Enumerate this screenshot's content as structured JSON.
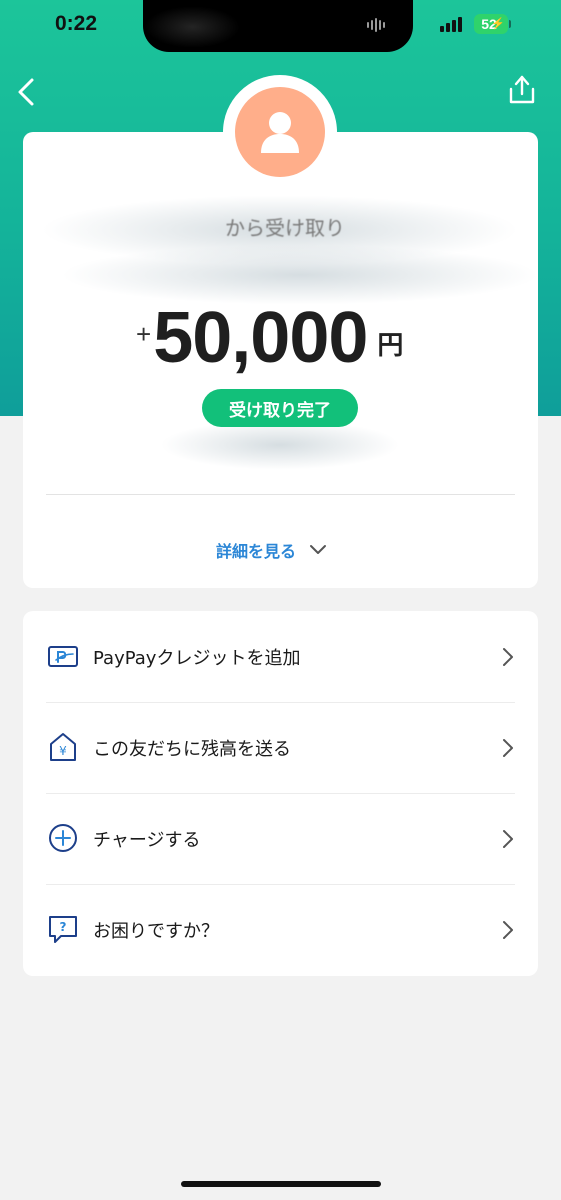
{
  "status_bar": {
    "time": "0:22",
    "battery": "52"
  },
  "card": {
    "sender_label": "から受け取り",
    "amount_sign": "+",
    "amount": "50,000",
    "amount_unit": "円",
    "status": "受け取り完了",
    "details_link": "詳細を見る"
  },
  "menu": {
    "items": [
      {
        "label": "PayPayクレジットを追加",
        "icon": "paypay-card-icon"
      },
      {
        "label": "この友だちに残高を送る",
        "icon": "yen-house-icon"
      },
      {
        "label": "チャージする",
        "icon": "plus-circle-icon"
      },
      {
        "label": "お困りですか？",
        "icon": "help-bubble-icon"
      }
    ]
  },
  "colors": {
    "header_top": "#1cc59a",
    "header_bottom": "#0f9e9a",
    "avatar": "#ffae8a",
    "status_pill": "#12c07a",
    "link": "#2b86d6",
    "icon_navy": "#1d3f8a"
  }
}
